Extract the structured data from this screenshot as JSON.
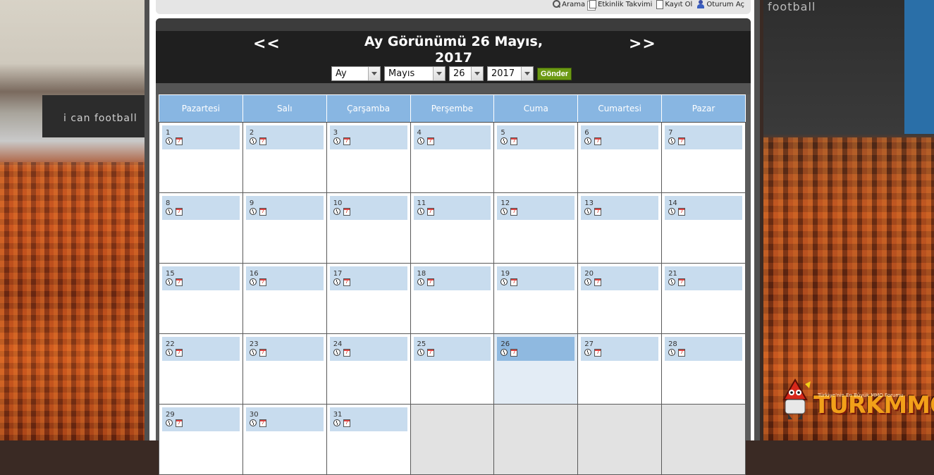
{
  "nav": {
    "links": [
      {
        "label": "Arama",
        "icon": "search-icon"
      },
      {
        "label": "Etkinlik Takvimi",
        "icon": "document-icon"
      },
      {
        "label": "Kayıt Ol",
        "icon": "document-icon"
      },
      {
        "label": "Oturum Aç",
        "icon": "user-icon"
      }
    ]
  },
  "calendar": {
    "prev_label": "<<",
    "next_label": ">>",
    "title_line1": "Ay Görünümü 26 Mayıs,",
    "title_line2": "2017",
    "controls": {
      "view": "Ay",
      "month": "Mayıs",
      "day": "26",
      "year": "2017",
      "submit": "Gönder"
    },
    "weekdays": [
      "Pazartesi",
      "Salı",
      "Çarşamba",
      "Perşembe",
      "Cuma",
      "Cumartesi",
      "Pazar"
    ],
    "weeks": [
      [
        "1",
        "2",
        "3",
        "4",
        "5",
        "6",
        "7"
      ],
      [
        "8",
        "9",
        "10",
        "11",
        "12",
        "13",
        "14"
      ],
      [
        "15",
        "16",
        "17",
        "18",
        "19",
        "20",
        "21"
      ],
      [
        "22",
        "23",
        "24",
        "25",
        "26",
        "27",
        "28"
      ],
      [
        "29",
        "30",
        "31",
        "",
        "",
        "",
        ""
      ]
    ],
    "today": "26",
    "cell_icon_label": "7",
    "colors": {
      "header_bg": "#88b6e2",
      "day_bg": "#c8dcee",
      "today_bg": "#8fb9e0",
      "submit_bg": "#6c9a14"
    }
  },
  "logo": {
    "title": "TURKMMO",
    "tagline": "Türkiye'nin En Büyük MMO Forumu"
  },
  "background": {
    "left_banner": "i can football",
    "right_banner": "football"
  }
}
